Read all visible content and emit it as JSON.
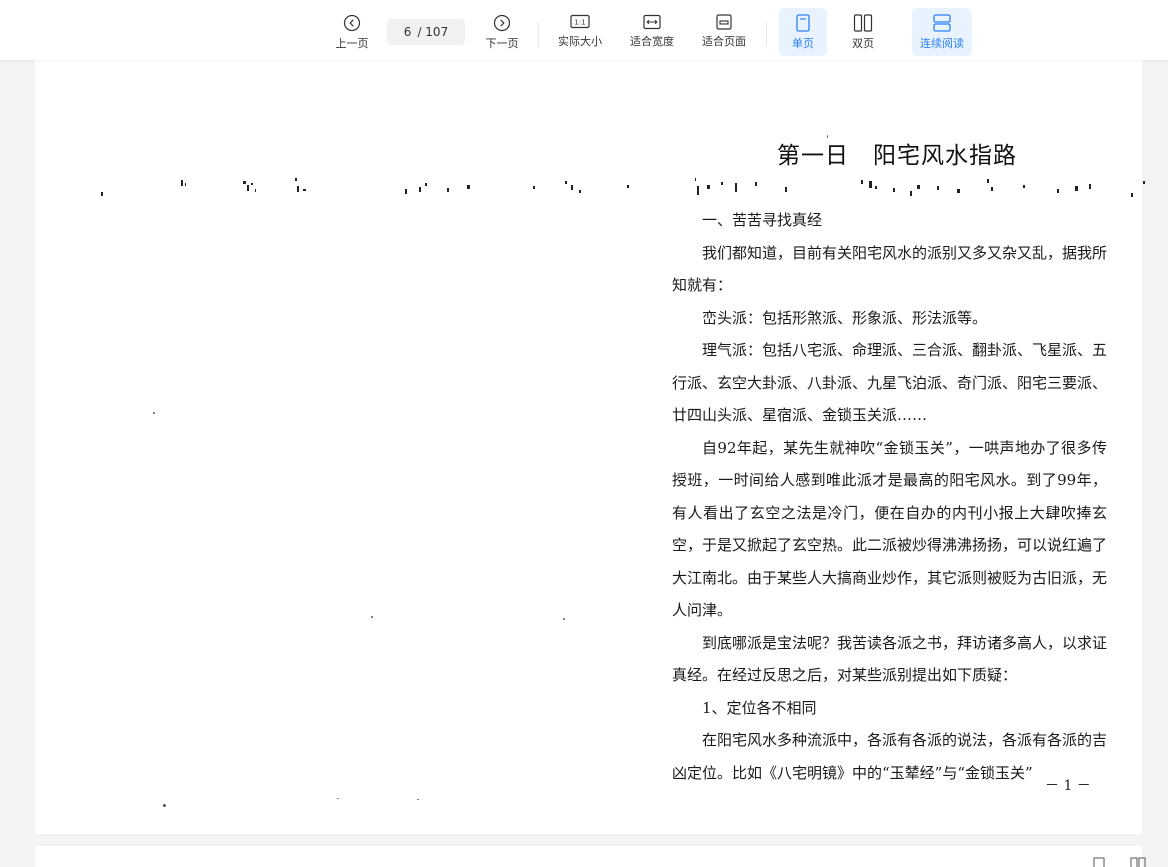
{
  "toolbar": {
    "prev_label": "上一页",
    "page_current": "6",
    "page_total": "/ 107",
    "next_label": "下一页",
    "actual_size_label": "实际大小",
    "actual_size_glyph": "1:1",
    "fit_width_label": "适合宽度",
    "fit_page_label": "适合页面",
    "single_label": "单页",
    "double_label": "双页",
    "continuous_label": "连续阅读",
    "accent_color": "#2d7ff9",
    "icons": [
      "chevron-left-circle-icon",
      "chevron-right-circle-icon",
      "actual-size-icon",
      "fit-width-icon",
      "fit-page-icon",
      "single-page-icon",
      "double-page-icon",
      "continuous-read-icon"
    ]
  },
  "page": {
    "chapter_title": "第一日　阳宅风水指路",
    "paragraphs": [
      "一、苦苦寻找真经",
      "我们都知道，目前有关阳宅风水的派别又多又杂又乱，据我所知就有：",
      "峦头派：包括形煞派、形象派、形法派等。",
      "理气派：包括八宅派、命理派、三合派、翻卦派、飞星派、五行派、玄空大卦派、八卦派、九星飞泊派、奇门派、阳宅三要派、廿四山头派、星宿派、金锁玉关派……",
      "自92年起，某先生就神吹“金锁玉关”，一哄声地办了很多传授班，一时间给人感到唯此派才是最高的阳宅风水。到了99年，有人看出了玄空之法是冷门，便在自办的内刊小报上大肆吹捧玄空，于是又掀起了玄空热。此二派被炒得沸沸扬扬，可以说红遍了大江南北。由于某些人大搞商业炒作，其它派则被贬为古旧派，无人问津。",
      "到底哪派是宝法呢？我苦读各派之书，拜访诸多高人，以求证真经。在经过反思之后，对某些派别提出如下质疑：",
      "1、定位各不相同",
      "在阳宅风水多种流派中，各派有各派的说法，各派有各派的吉凶定位。比如《八宅明镜》中的“玉辇经”与“金锁玉关”"
    ],
    "page_number": "－ 1 －"
  }
}
